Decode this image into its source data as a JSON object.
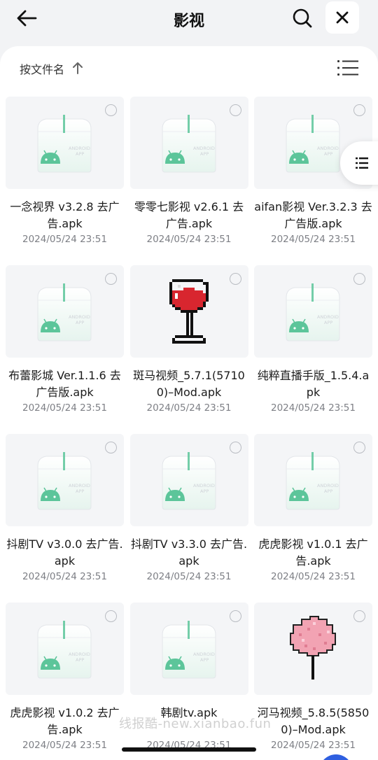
{
  "header": {
    "title": "影视",
    "back_icon": "arrow-left-icon",
    "search_icon": "search-icon",
    "close_icon": "close-icon"
  },
  "sortbar": {
    "label": "按文件名",
    "direction_icon": "arrow-up-icon",
    "view_icon": "list-view-icon"
  },
  "files": [
    {
      "name": "一念视界 v3.2.8 去广告.apk",
      "time": "2024/05/24 23:51",
      "icon": "android-apk-icon"
    },
    {
      "name": "零零七影视 v2.6.1 去广告.apk",
      "time": "2024/05/24 23:51",
      "icon": "android-apk-icon"
    },
    {
      "name": "aifan影视 Ver.3.2.3 去广告版.apk",
      "time": "2024/05/24 23:51",
      "icon": "android-apk-icon"
    },
    {
      "name": "布蕾影城 Ver.1.1.6 去广告版.apk",
      "time": "2024/05/24 23:51",
      "icon": "android-apk-icon"
    },
    {
      "name": "斑马视频_5.7.1(57100)–Mod.apk",
      "time": "2024/05/24 23:51",
      "icon": "wine-glass-icon"
    },
    {
      "name": "纯粹直播手版_1.5.4.apk",
      "time": "2024/05/24 23:51",
      "icon": "android-apk-icon"
    },
    {
      "name": "抖剧TV v3.0.0 去广告.apk",
      "time": "2024/05/24 23:51",
      "icon": "android-apk-icon"
    },
    {
      "name": "抖剧TV v3.3.0 去广告.apk",
      "time": "2024/05/24 23:51",
      "icon": "android-apk-icon"
    },
    {
      "name": "虎虎影视 v1.0.1 去广告.apk",
      "time": "2024/05/24 23:51",
      "icon": "android-apk-icon"
    },
    {
      "name": "虎虎影视 v1.0.2 去广告.apk",
      "time": "2024/05/24 23:51",
      "icon": "android-apk-icon"
    },
    {
      "name": "韩剧tv.apk",
      "time": "2024/05/24 23:51",
      "icon": "android-apk-icon"
    },
    {
      "name": "河马视频_5.8.5(58500)–Mod.apk",
      "time": "2024/05/24 23:51",
      "icon": "cotton-candy-icon"
    }
  ],
  "apk_placeholder_text": [
    "ANDROID",
    "APP"
  ],
  "side_menu_icon": "menu-icon",
  "watermark": "线报酷-new.xianbao.fun",
  "colors": {
    "android_green": "#5cc59a",
    "wine_red": "#d8262f",
    "candy_pink": "#f2a3b3"
  }
}
